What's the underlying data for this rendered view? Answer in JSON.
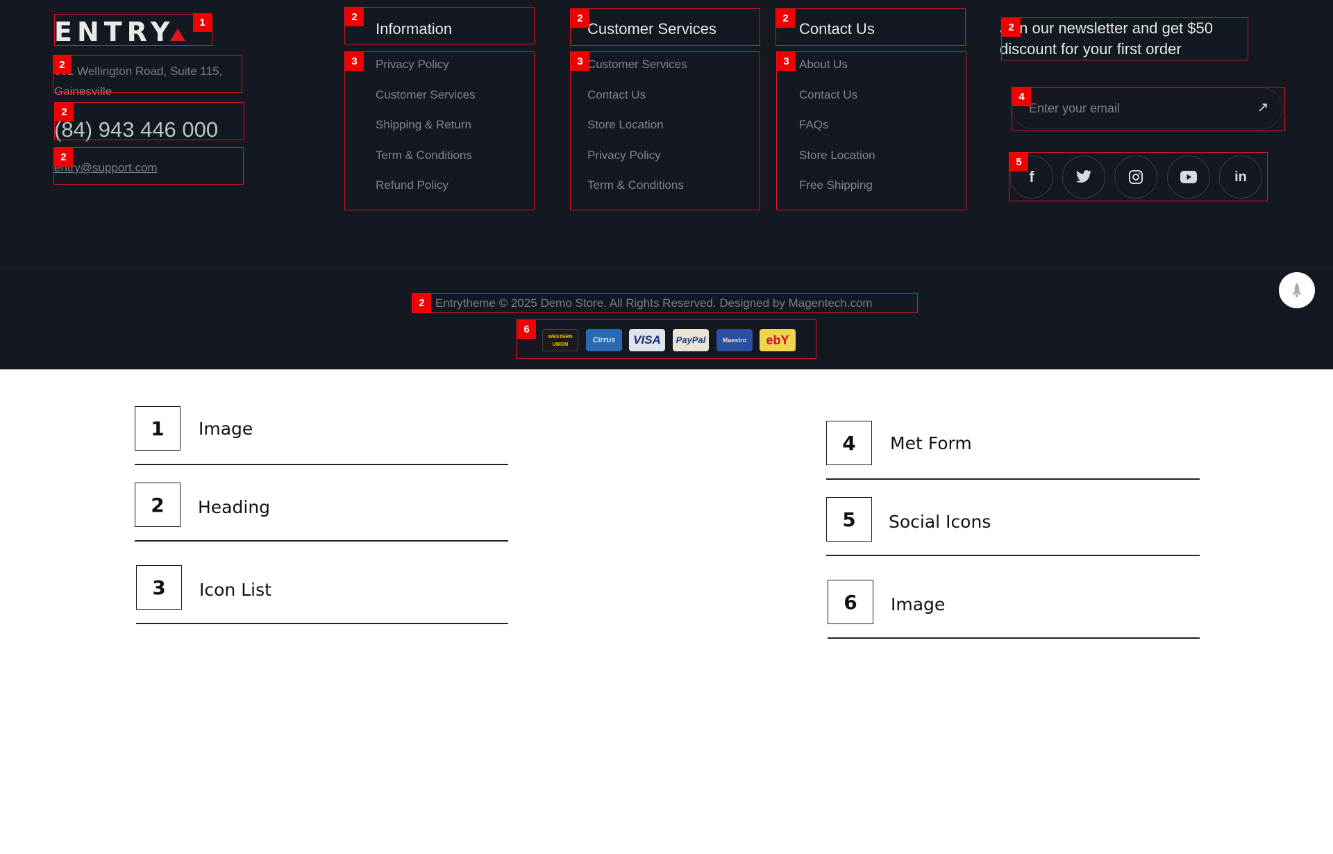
{
  "footer": {
    "logo": "ENTRY",
    "address": "301 Wellington Road, Suite 115, Gainesville",
    "phone": "(84) 943 446 000",
    "email": "entry@support.com",
    "columns": [
      {
        "title": "Information",
        "items": [
          "Privacy Policy",
          "Customer Services",
          "Shipping & Return",
          "Term & Conditions",
          "Refund Policy"
        ]
      },
      {
        "title": "Customer Services",
        "items": [
          "Customer Services",
          "Contact Us",
          "Store Location",
          "Privacy Policy",
          "Term & Conditions"
        ]
      },
      {
        "title": "Contact Us",
        "items": [
          "About Us",
          "Contact Us",
          "FAQs",
          "Store Location",
          "Free Shipping"
        ]
      }
    ],
    "newsletter": {
      "title": "Join our newsletter and get $50 discount for your first order",
      "placeholder": "Enter your email",
      "submit_icon": "arrow-up-right-icon"
    },
    "social": [
      {
        "name": "facebook-icon",
        "glyph": "f"
      },
      {
        "name": "twitter-icon",
        "glyph": "🐦"
      },
      {
        "name": "instagram-icon",
        "glyph": "◎"
      },
      {
        "name": "youtube-icon",
        "glyph": "▶"
      },
      {
        "name": "linkedin-icon",
        "glyph": "in"
      }
    ],
    "copyright": "Entrytheme © 2025 Demo Store. All Rights Reserved. Designed by Magentech.com",
    "payments": [
      "WESTERN UNION",
      "Cirrus",
      "VISA",
      "PayPal",
      "Maestro",
      "ebY"
    ]
  },
  "annotations": {
    "badges": [
      "1",
      "2",
      "3",
      "4",
      "5",
      "6"
    ]
  },
  "legend": [
    {
      "number": "1",
      "label": "Image"
    },
    {
      "number": "2",
      "label": "Heading"
    },
    {
      "number": "3",
      "label": "Icon List"
    },
    {
      "number": "4",
      "label": "Met Form"
    },
    {
      "number": "5",
      "label": "Social Icons"
    },
    {
      "number": "6",
      "label": "Image"
    }
  ],
  "colors": {
    "footer_bg": "#141820",
    "annotation_red": "#e0161e",
    "text_muted": "#7a7f88",
    "heading": "#e6e7ea"
  }
}
